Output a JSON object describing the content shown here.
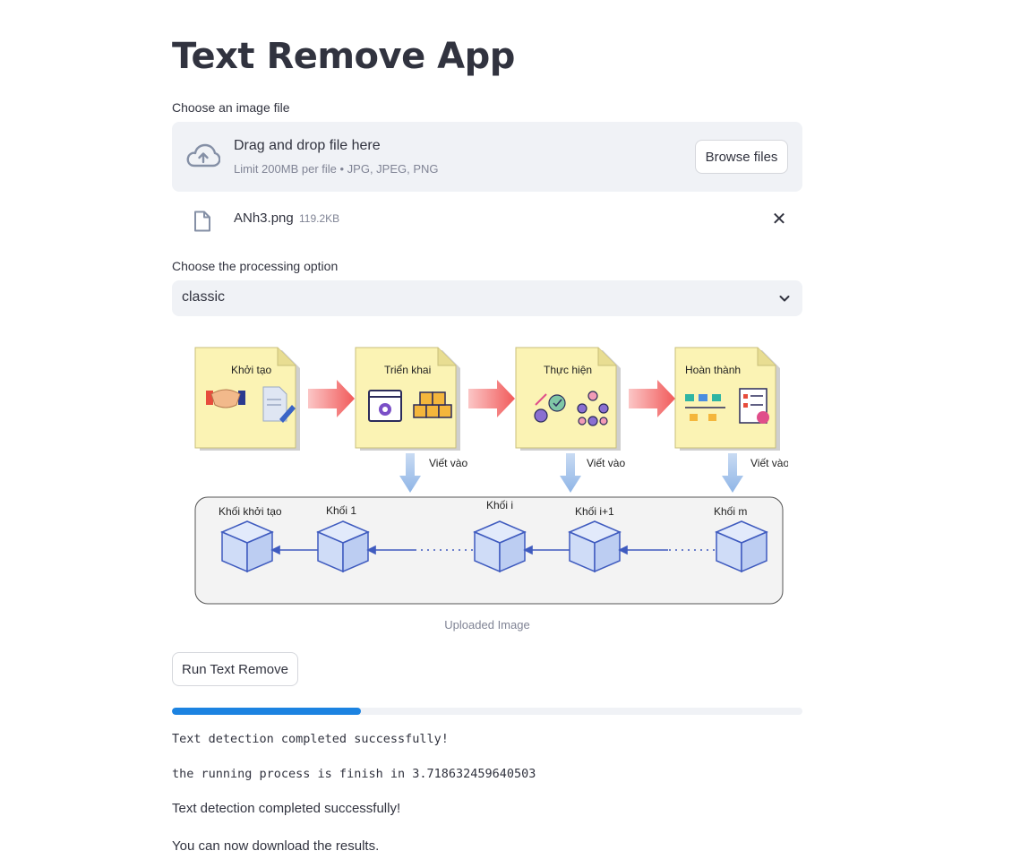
{
  "app": {
    "title": "Text Remove App"
  },
  "uploader": {
    "label": "Choose an image file",
    "dropzone_title": "Drag and drop file here",
    "dropzone_limit": "Limit 200MB per file • JPG, JPEG, PNG",
    "browse_label": "Browse files",
    "file": {
      "name": "ANh3.png",
      "size": "119.2KB"
    }
  },
  "processing": {
    "label": "Choose the processing option",
    "selected": "classic"
  },
  "image": {
    "caption": "Uploaded Image",
    "stages": [
      "Khởi tạo",
      "Triển khai",
      "Thực hiện",
      "Hoàn thành"
    ],
    "write_label": "Viết vào",
    "blocks": [
      "Khối khởi tạo",
      "Khối 1",
      "Khối i",
      "Khối i+1",
      "Khối m"
    ]
  },
  "run": {
    "label": "Run Text Remove"
  },
  "progress": {
    "percent": 30
  },
  "output": {
    "code_lines": [
      "Text detection completed successfully!",
      "the running process is finish in 3.718632459640503"
    ],
    "messages": [
      "Text detection completed successfully!",
      "You can now download the results."
    ]
  },
  "colors": {
    "accent": "#1c83e1",
    "note_fill": "#fbf3b4",
    "arrow_red": "#f47373",
    "cube_fill": "#cfdcf7",
    "cube_stroke": "#3f5bbf"
  }
}
